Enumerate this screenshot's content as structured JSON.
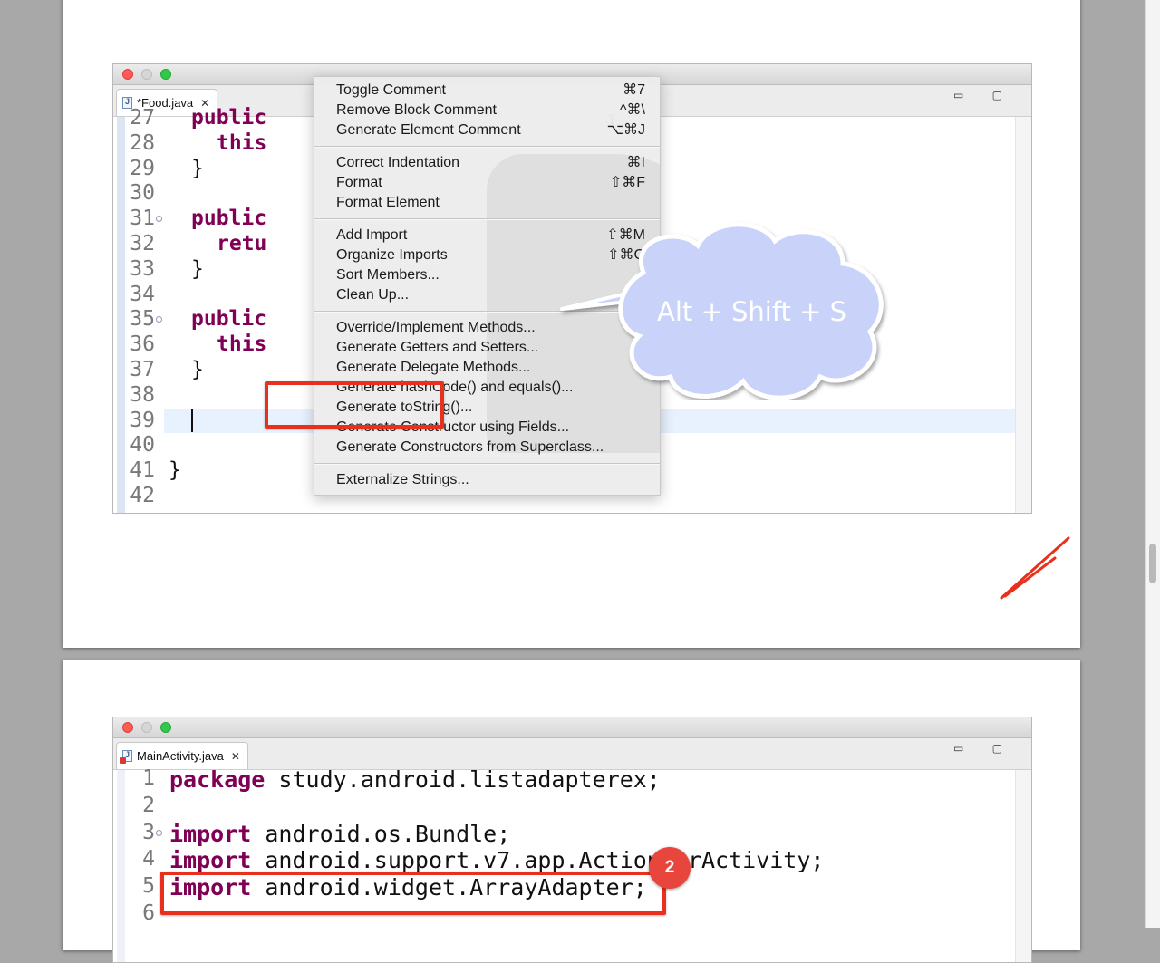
{
  "window1": {
    "tab_label": "*Food.java",
    "tab_close": "✕",
    "window_buttons": "▭ ▢",
    "line_numbers": [
      "27",
      "28",
      "29",
      "30",
      "31",
      "32",
      "33",
      "34",
      "35",
      "36",
      "37",
      "38",
      "39",
      "40",
      "41",
      "42"
    ],
    "code_lines": [
      {
        "kw": "public",
        "rest": ""
      },
      {
        "kw": "this",
        "rest": ""
      },
      {
        "kw": "",
        "rest": "}"
      },
      {
        "kw": "",
        "rest": ""
      },
      {
        "kw": "public",
        "rest": ""
      },
      {
        "kw": "retu",
        "rest": ""
      },
      {
        "kw": "",
        "rest": "}"
      },
      {
        "kw": "",
        "rest": ""
      },
      {
        "kw": "public",
        "rest": ""
      },
      {
        "kw": "this",
        "rest": ""
      },
      {
        "kw": "",
        "rest": "}"
      },
      {
        "kw": "",
        "rest": ""
      },
      {
        "kw": "",
        "rest": ""
      },
      {
        "kw": "",
        "rest": ""
      },
      {
        "kw": "",
        "rest": "}"
      },
      {
        "kw": "",
        "rest": ""
      }
    ],
    "hidden_tail": "l"
  },
  "context_menu": {
    "groups": [
      [
        {
          "label": "Toggle Comment",
          "shortcut": "⌘7"
        },
        {
          "label": "Remove Block Comment",
          "shortcut": "^⌘\\"
        },
        {
          "label": "Generate Element Comment",
          "shortcut": "⌥⌘J"
        }
      ],
      [
        {
          "label": "Correct Indentation",
          "shortcut": "⌘I"
        },
        {
          "label": "Format",
          "shortcut": "⇧⌘F"
        },
        {
          "label": "Format Element",
          "shortcut": ""
        }
      ],
      [
        {
          "label": "Add Import",
          "shortcut": "⇧⌘M"
        },
        {
          "label": "Organize Imports",
          "shortcut": "⇧⌘O"
        },
        {
          "label": "Sort Members...",
          "shortcut": ""
        },
        {
          "label": "Clean Up...",
          "shortcut": ""
        }
      ],
      [
        {
          "label": "Override/Implement Methods...",
          "shortcut": ""
        },
        {
          "label": "Generate Getters and Setters...",
          "shortcut": ""
        },
        {
          "label": "Generate Delegate Methods...",
          "shortcut": ""
        },
        {
          "label": "Generate hashCode() and equals()...",
          "shortcut": ""
        },
        {
          "label": "Generate toString()...",
          "shortcut": ""
        },
        {
          "label": "Generate Constructor using Fields...",
          "shortcut": ""
        },
        {
          "label": "Generate Constructors from Superclass...",
          "shortcut": ""
        }
      ],
      [
        {
          "label": "Externalize Strings...",
          "shortcut": ""
        }
      ]
    ]
  },
  "callout": {
    "text": "Alt + Shift + S"
  },
  "window2": {
    "tab_label": "MainActivity.java",
    "tab_close": "✕",
    "window_buttons": "▭ ▢",
    "line_numbers": [
      "1",
      "2",
      "3",
      "4",
      "5",
      "6"
    ],
    "code_lines": [
      {
        "kw": "package",
        "rest": " study.android.listadapterex;"
      },
      {
        "kw": "",
        "rest": ""
      },
      {
        "kw": "import",
        "rest": " android.os.Bundle;"
      },
      {
        "kw": "import",
        "rest": " android.support.v7.app.ActionBarActivity;"
      },
      {
        "kw": "import",
        "rest": " android.widget.ArrayAdapter;"
      },
      {
        "kw": "",
        "rest": ""
      }
    ]
  },
  "badge": {
    "number": "2"
  },
  "colors": {
    "highlight": "#e8301c",
    "keyword": "#7f0055",
    "cloud": "#c9d2f8",
    "badge": "#e8453c"
  }
}
